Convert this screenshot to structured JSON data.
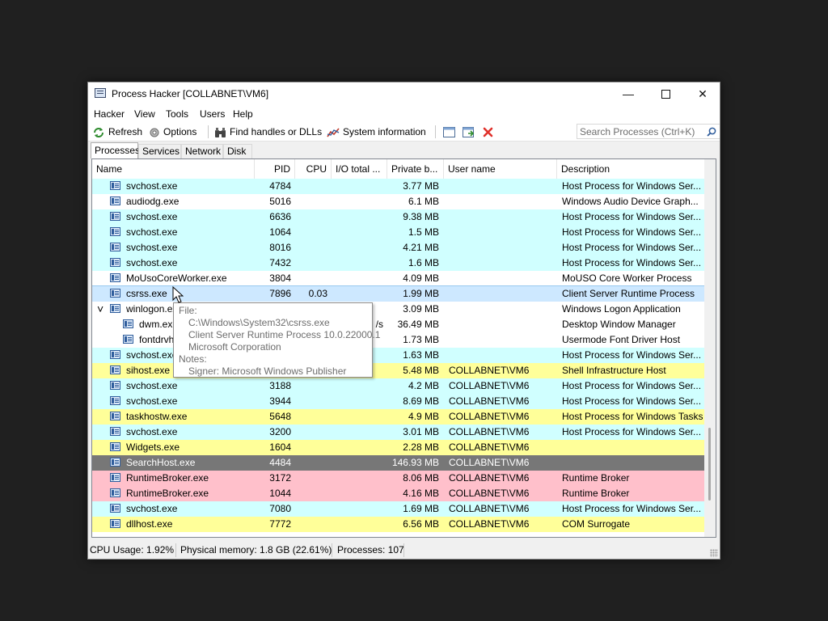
{
  "window": {
    "title": "Process Hacker [COLLABNET\\VM6]"
  },
  "menu": [
    "Hacker",
    "View",
    "Tools",
    "Users",
    "Help"
  ],
  "toolbar": {
    "refresh": "Refresh",
    "options": "Options",
    "find_handles": "Find handles or DLLs",
    "system_info": "System information",
    "search_placeholder": "Search Processes (Ctrl+K)"
  },
  "tabs": [
    "Processes",
    "Services",
    "Network",
    "Disk"
  ],
  "columns": [
    "Name",
    "PID",
    "CPU",
    "I/O total ...",
    "Private b...",
    "User name",
    "Description"
  ],
  "colors": {
    "service": "#d0ffff",
    "own": "#ffff99",
    "selected": "#cde8ff",
    "suspended": "#777777",
    "elevated": "#ffc0cb",
    "normal": "#ffffff"
  },
  "processes": [
    {
      "name": "svchost.exe",
      "pid": "4784",
      "cpu": "",
      "io": "",
      "priv": "3.77 MB",
      "user": "",
      "desc": "Host Process for Windows Ser...",
      "type": "service",
      "indent": 1
    },
    {
      "name": "audiodg.exe",
      "pid": "5016",
      "cpu": "",
      "io": "",
      "priv": "6.1 MB",
      "user": "",
      "desc": "Windows Audio Device Graph...",
      "type": "normal",
      "indent": 1
    },
    {
      "name": "svchost.exe",
      "pid": "6636",
      "cpu": "",
      "io": "",
      "priv": "9.38 MB",
      "user": "",
      "desc": "Host Process for Windows Ser...",
      "type": "service",
      "indent": 1
    },
    {
      "name": "svchost.exe",
      "pid": "1064",
      "cpu": "",
      "io": "",
      "priv": "1.5 MB",
      "user": "",
      "desc": "Host Process for Windows Ser...",
      "type": "service",
      "indent": 1
    },
    {
      "name": "svchost.exe",
      "pid": "8016",
      "cpu": "",
      "io": "",
      "priv": "4.21 MB",
      "user": "",
      "desc": "Host Process for Windows Ser...",
      "type": "service",
      "indent": 1
    },
    {
      "name": "svchost.exe",
      "pid": "7432",
      "cpu": "",
      "io": "",
      "priv": "1.6 MB",
      "user": "",
      "desc": "Host Process for Windows Ser...",
      "type": "service",
      "indent": 1
    },
    {
      "name": "MoUsoCoreWorker.exe",
      "pid": "3804",
      "cpu": "",
      "io": "",
      "priv": "4.09 MB",
      "user": "",
      "desc": "MoUSO Core Worker Process",
      "type": "normal",
      "indent": 1
    },
    {
      "name": "csrss.exe",
      "pid": "7896",
      "cpu": "0.03",
      "io": "",
      "priv": "1.99 MB",
      "user": "",
      "desc": "Client Server Runtime Process",
      "type": "selected",
      "indent": 1
    },
    {
      "name": "winlogon.exe",
      "pid": "",
      "cpu": "",
      "io": "",
      "priv": "3.09 MB",
      "user": "",
      "desc": "Windows Logon Application",
      "type": "normal",
      "indent": 1,
      "expanded": true
    },
    {
      "name": "dwm.exe",
      "pid": "",
      "cpu": "",
      "io": "/s",
      "priv": "36.49 MB",
      "user": "",
      "desc": "Desktop Window Manager",
      "type": "normal",
      "indent": 2
    },
    {
      "name": "fontdrvhost.exe",
      "pid": "",
      "cpu": "",
      "io": "",
      "priv": "1.73 MB",
      "user": "",
      "desc": "Usermode Font Driver Host",
      "type": "normal",
      "indent": 2
    },
    {
      "name": "svchost.exe",
      "pid": "",
      "cpu": "",
      "io": "",
      "priv": "1.63 MB",
      "user": "",
      "desc": "Host Process for Windows Ser...",
      "type": "service",
      "indent": 1
    },
    {
      "name": "sihost.exe",
      "pid": "",
      "cpu": "",
      "io": "",
      "priv": "5.48 MB",
      "user": "COLLABNET\\VM6",
      "desc": "Shell Infrastructure Host",
      "type": "own",
      "indent": 1
    },
    {
      "name": "svchost.exe",
      "pid": "3188",
      "cpu": "",
      "io": "",
      "priv": "4.2 MB",
      "user": "COLLABNET\\VM6",
      "desc": "Host Process for Windows Ser...",
      "type": "service",
      "indent": 1
    },
    {
      "name": "svchost.exe",
      "pid": "3944",
      "cpu": "",
      "io": "",
      "priv": "8.69 MB",
      "user": "COLLABNET\\VM6",
      "desc": "Host Process for Windows Ser...",
      "type": "service",
      "indent": 1
    },
    {
      "name": "taskhostw.exe",
      "pid": "5648",
      "cpu": "",
      "io": "",
      "priv": "4.9 MB",
      "user": "COLLABNET\\VM6",
      "desc": "Host Process for Windows Tasks",
      "type": "own",
      "indent": 1
    },
    {
      "name": "svchost.exe",
      "pid": "3200",
      "cpu": "",
      "io": "",
      "priv": "3.01 MB",
      "user": "COLLABNET\\VM6",
      "desc": "Host Process for Windows Ser...",
      "type": "service",
      "indent": 1
    },
    {
      "name": "Widgets.exe",
      "pid": "1604",
      "cpu": "",
      "io": "",
      "priv": "2.28 MB",
      "user": "COLLABNET\\VM6",
      "desc": "",
      "type": "own",
      "indent": 1
    },
    {
      "name": "SearchHost.exe",
      "pid": "4484",
      "cpu": "",
      "io": "",
      "priv": "146.93 MB",
      "user": "COLLABNET\\VM6",
      "desc": "",
      "type": "suspended",
      "indent": 1
    },
    {
      "name": "RuntimeBroker.exe",
      "pid": "3172",
      "cpu": "",
      "io": "",
      "priv": "8.06 MB",
      "user": "COLLABNET\\VM6",
      "desc": "Runtime Broker",
      "type": "elevated",
      "indent": 1
    },
    {
      "name": "RuntimeBroker.exe",
      "pid": "1044",
      "cpu": "",
      "io": "",
      "priv": "4.16 MB",
      "user": "COLLABNET\\VM6",
      "desc": "Runtime Broker",
      "type": "elevated",
      "indent": 1
    },
    {
      "name": "svchost.exe",
      "pid": "7080",
      "cpu": "",
      "io": "",
      "priv": "1.69 MB",
      "user": "COLLABNET\\VM6",
      "desc": "Host Process for Windows Ser...",
      "type": "service",
      "indent": 1
    },
    {
      "name": "dllhost.exe",
      "pid": "7772",
      "cpu": "",
      "io": "",
      "priv": "6.56 MB",
      "user": "COLLABNET\\VM6",
      "desc": "COM Surrogate",
      "type": "own",
      "indent": 1
    }
  ],
  "tooltip": {
    "file_label": "File:",
    "path": "C:\\Windows\\System32\\csrss.exe",
    "version": "Client Server Runtime Process 10.0.22000.1",
    "company": "Microsoft Corporation",
    "notes_label": "Notes:",
    "signer": "Signer: Microsoft Windows Publisher"
  },
  "status": {
    "cpu": "CPU Usage: 1.92%",
    "memory": "Physical memory: 1.8 GB (22.61%)",
    "processes": "Processes: 107"
  }
}
